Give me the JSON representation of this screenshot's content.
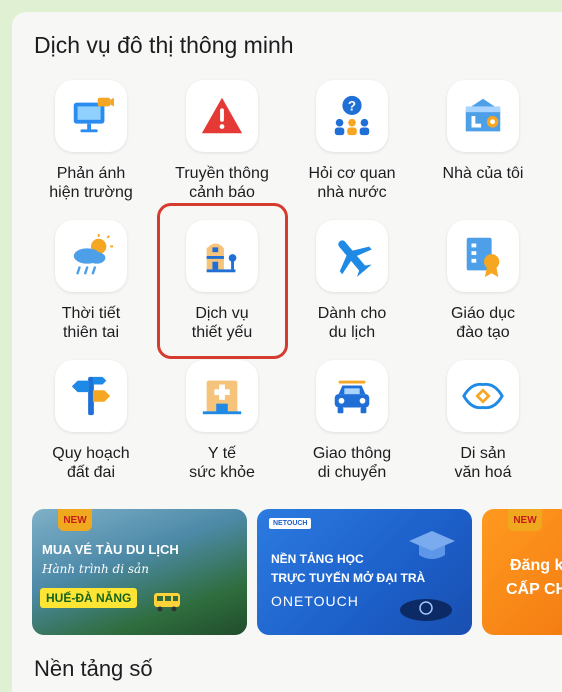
{
  "section_title": "Dịch vụ đô thị thông minh",
  "services": [
    {
      "label": "Phản ánh\nhiện trường",
      "icon": "monitor-camera-icon"
    },
    {
      "label": "Truyền thông\ncảnh báo",
      "icon": "warning-triangle-icon"
    },
    {
      "label": "Hỏi cơ quan\nnhà nước",
      "icon": "question-people-icon"
    },
    {
      "label": "Nhà của tôi",
      "icon": "home-location-icon"
    },
    {
      "label": "Thời tiết\nthiên tai",
      "icon": "weather-icon"
    },
    {
      "label": "Dịch vụ\nthiết yếu",
      "icon": "essential-service-icon"
    },
    {
      "label": "Dành cho\ndu lịch",
      "icon": "airplane-icon"
    },
    {
      "label": "Giáo dục\nđào tạo",
      "icon": "certificate-icon"
    },
    {
      "label": "Quy hoạch\nđất đai",
      "icon": "signpost-icon"
    },
    {
      "label": "Y tế\nsức khỏe",
      "icon": "hospital-icon"
    },
    {
      "label": "Giao thông\ndi chuyển",
      "icon": "car-icon"
    },
    {
      "label": "Di sản\nvăn hoá",
      "icon": "heritage-icon"
    }
  ],
  "banners": [
    {
      "badge": "NEW",
      "title": "MUA VÉ TÀU DU LỊCH",
      "subtitle": "Hành trình di sản",
      "route": "HUẾ-ĐÀ NẴNG"
    },
    {
      "logo": "NETOUCH",
      "line1": "NỀN TẢNG HỌC",
      "line2": "TRỰC TUYẾN MỞ ĐẠI TRÀ",
      "brand": "ONETOUCH"
    },
    {
      "badge": "NEW",
      "line1": "Đăng k",
      "line2": "CẤP CH"
    }
  ],
  "section2_title": "Nền tảng số",
  "colors": {
    "highlight": "#d63b2f",
    "accent_blue": "#1f8ae6",
    "page_bg": "#dff1d2"
  }
}
